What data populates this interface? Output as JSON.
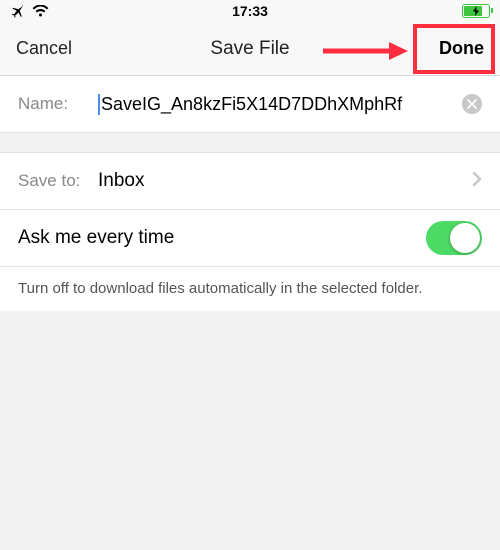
{
  "status": {
    "time": "17:33"
  },
  "nav": {
    "cancel": "Cancel",
    "title": "Save File",
    "done": "Done"
  },
  "form": {
    "name_label": "Name:",
    "name_value": "SaveIG_An8kzFi5X14D7DDhXMphRf",
    "save_to_label": "Save to:",
    "save_to_value": "Inbox",
    "ask_label": "Ask me every time",
    "footer": "Turn off to download files automatically in the selected folder."
  }
}
